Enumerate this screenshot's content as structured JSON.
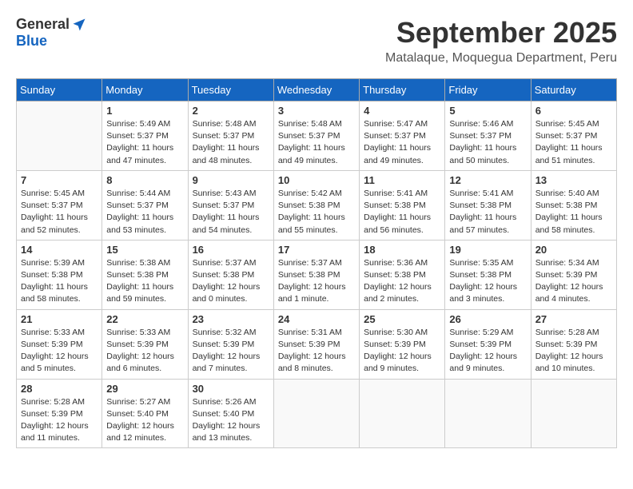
{
  "header": {
    "logo_general": "General",
    "logo_blue": "Blue",
    "month_title": "September 2025",
    "location": "Matalaque, Moquegua Department, Peru"
  },
  "days_of_week": [
    "Sunday",
    "Monday",
    "Tuesday",
    "Wednesday",
    "Thursday",
    "Friday",
    "Saturday"
  ],
  "weeks": [
    [
      {
        "day": "",
        "sunrise": "",
        "sunset": "",
        "daylight": ""
      },
      {
        "day": "1",
        "sunrise": "Sunrise: 5:49 AM",
        "sunset": "Sunset: 5:37 PM",
        "daylight": "Daylight: 11 hours and 47 minutes."
      },
      {
        "day": "2",
        "sunrise": "Sunrise: 5:48 AM",
        "sunset": "Sunset: 5:37 PM",
        "daylight": "Daylight: 11 hours and 48 minutes."
      },
      {
        "day": "3",
        "sunrise": "Sunrise: 5:48 AM",
        "sunset": "Sunset: 5:37 PM",
        "daylight": "Daylight: 11 hours and 49 minutes."
      },
      {
        "day": "4",
        "sunrise": "Sunrise: 5:47 AM",
        "sunset": "Sunset: 5:37 PM",
        "daylight": "Daylight: 11 hours and 49 minutes."
      },
      {
        "day": "5",
        "sunrise": "Sunrise: 5:46 AM",
        "sunset": "Sunset: 5:37 PM",
        "daylight": "Daylight: 11 hours and 50 minutes."
      },
      {
        "day": "6",
        "sunrise": "Sunrise: 5:45 AM",
        "sunset": "Sunset: 5:37 PM",
        "daylight": "Daylight: 11 hours and 51 minutes."
      }
    ],
    [
      {
        "day": "7",
        "sunrise": "Sunrise: 5:45 AM",
        "sunset": "Sunset: 5:37 PM",
        "daylight": "Daylight: 11 hours and 52 minutes."
      },
      {
        "day": "8",
        "sunrise": "Sunrise: 5:44 AM",
        "sunset": "Sunset: 5:37 PM",
        "daylight": "Daylight: 11 hours and 53 minutes."
      },
      {
        "day": "9",
        "sunrise": "Sunrise: 5:43 AM",
        "sunset": "Sunset: 5:37 PM",
        "daylight": "Daylight: 11 hours and 54 minutes."
      },
      {
        "day": "10",
        "sunrise": "Sunrise: 5:42 AM",
        "sunset": "Sunset: 5:38 PM",
        "daylight": "Daylight: 11 hours and 55 minutes."
      },
      {
        "day": "11",
        "sunrise": "Sunrise: 5:41 AM",
        "sunset": "Sunset: 5:38 PM",
        "daylight": "Daylight: 11 hours and 56 minutes."
      },
      {
        "day": "12",
        "sunrise": "Sunrise: 5:41 AM",
        "sunset": "Sunset: 5:38 PM",
        "daylight": "Daylight: 11 hours and 57 minutes."
      },
      {
        "day": "13",
        "sunrise": "Sunrise: 5:40 AM",
        "sunset": "Sunset: 5:38 PM",
        "daylight": "Daylight: 11 hours and 58 minutes."
      }
    ],
    [
      {
        "day": "14",
        "sunrise": "Sunrise: 5:39 AM",
        "sunset": "Sunset: 5:38 PM",
        "daylight": "Daylight: 11 hours and 58 minutes."
      },
      {
        "day": "15",
        "sunrise": "Sunrise: 5:38 AM",
        "sunset": "Sunset: 5:38 PM",
        "daylight": "Daylight: 11 hours and 59 minutes."
      },
      {
        "day": "16",
        "sunrise": "Sunrise: 5:37 AM",
        "sunset": "Sunset: 5:38 PM",
        "daylight": "Daylight: 12 hours and 0 minutes."
      },
      {
        "day": "17",
        "sunrise": "Sunrise: 5:37 AM",
        "sunset": "Sunset: 5:38 PM",
        "daylight": "Daylight: 12 hours and 1 minute."
      },
      {
        "day": "18",
        "sunrise": "Sunrise: 5:36 AM",
        "sunset": "Sunset: 5:38 PM",
        "daylight": "Daylight: 12 hours and 2 minutes."
      },
      {
        "day": "19",
        "sunrise": "Sunrise: 5:35 AM",
        "sunset": "Sunset: 5:38 PM",
        "daylight": "Daylight: 12 hours and 3 minutes."
      },
      {
        "day": "20",
        "sunrise": "Sunrise: 5:34 AM",
        "sunset": "Sunset: 5:39 PM",
        "daylight": "Daylight: 12 hours and 4 minutes."
      }
    ],
    [
      {
        "day": "21",
        "sunrise": "Sunrise: 5:33 AM",
        "sunset": "Sunset: 5:39 PM",
        "daylight": "Daylight: 12 hours and 5 minutes."
      },
      {
        "day": "22",
        "sunrise": "Sunrise: 5:33 AM",
        "sunset": "Sunset: 5:39 PM",
        "daylight": "Daylight: 12 hours and 6 minutes."
      },
      {
        "day": "23",
        "sunrise": "Sunrise: 5:32 AM",
        "sunset": "Sunset: 5:39 PM",
        "daylight": "Daylight: 12 hours and 7 minutes."
      },
      {
        "day": "24",
        "sunrise": "Sunrise: 5:31 AM",
        "sunset": "Sunset: 5:39 PM",
        "daylight": "Daylight: 12 hours and 8 minutes."
      },
      {
        "day": "25",
        "sunrise": "Sunrise: 5:30 AM",
        "sunset": "Sunset: 5:39 PM",
        "daylight": "Daylight: 12 hours and 9 minutes."
      },
      {
        "day": "26",
        "sunrise": "Sunrise: 5:29 AM",
        "sunset": "Sunset: 5:39 PM",
        "daylight": "Daylight: 12 hours and 9 minutes."
      },
      {
        "day": "27",
        "sunrise": "Sunrise: 5:28 AM",
        "sunset": "Sunset: 5:39 PM",
        "daylight": "Daylight: 12 hours and 10 minutes."
      }
    ],
    [
      {
        "day": "28",
        "sunrise": "Sunrise: 5:28 AM",
        "sunset": "Sunset: 5:39 PM",
        "daylight": "Daylight: 12 hours and 11 minutes."
      },
      {
        "day": "29",
        "sunrise": "Sunrise: 5:27 AM",
        "sunset": "Sunset: 5:40 PM",
        "daylight": "Daylight: 12 hours and 12 minutes."
      },
      {
        "day": "30",
        "sunrise": "Sunrise: 5:26 AM",
        "sunset": "Sunset: 5:40 PM",
        "daylight": "Daylight: 12 hours and 13 minutes."
      },
      {
        "day": "",
        "sunrise": "",
        "sunset": "",
        "daylight": ""
      },
      {
        "day": "",
        "sunrise": "",
        "sunset": "",
        "daylight": ""
      },
      {
        "day": "",
        "sunrise": "",
        "sunset": "",
        "daylight": ""
      },
      {
        "day": "",
        "sunrise": "",
        "sunset": "",
        "daylight": ""
      }
    ]
  ]
}
